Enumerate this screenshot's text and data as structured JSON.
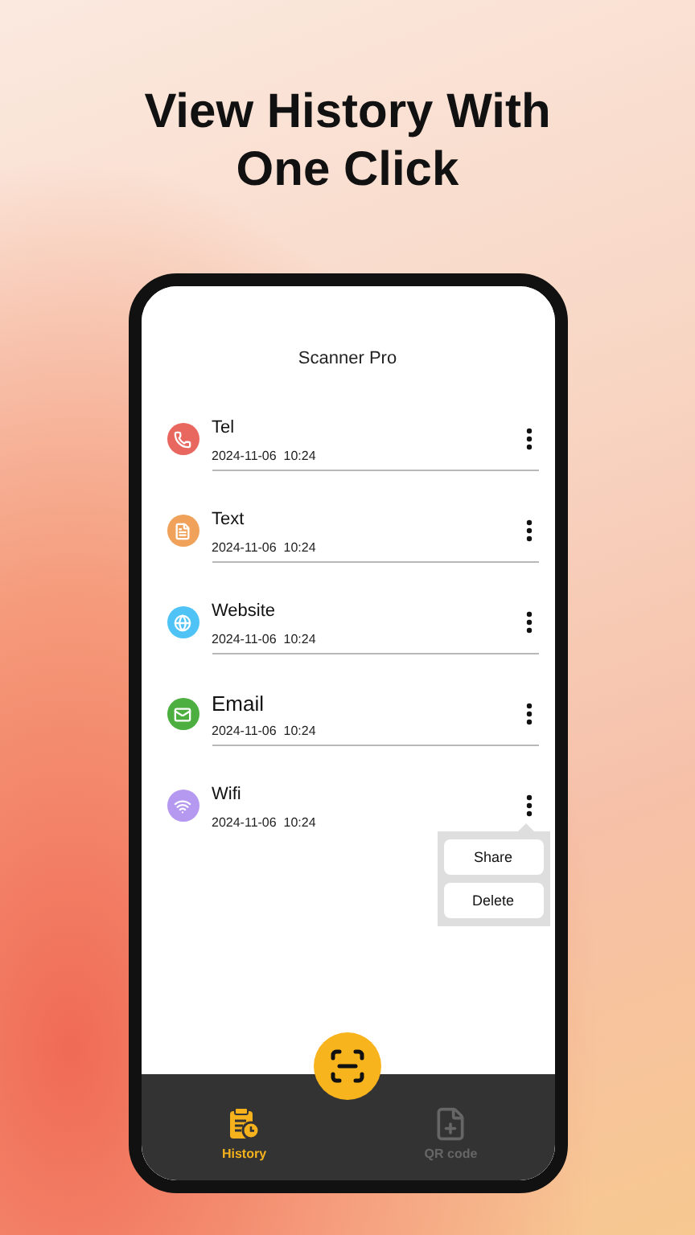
{
  "headline": "View History With One Click",
  "app": {
    "title": "Scanner Pro"
  },
  "history": [
    {
      "kind": "tel",
      "title": "Tel",
      "date": "2024-11-06  10:24",
      "color": "#e8675f",
      "menu_open": false
    },
    {
      "kind": "text",
      "title": "Text",
      "date": "2024-11-06  10:24",
      "color": "#f0a25a",
      "menu_open": false
    },
    {
      "kind": "website",
      "title": "Website",
      "date": "2024-11-06  10:24",
      "color": "#4fc3f5",
      "menu_open": false
    },
    {
      "kind": "email",
      "title": "Email",
      "date": "2024-11-06  10:24",
      "color": "#4caf3f",
      "menu_open": false
    },
    {
      "kind": "wifi",
      "title": "Wifi",
      "date": "2024-11-06  10:24",
      "color": "#b598ef",
      "menu_open": true
    }
  ],
  "menu": [
    "Share",
    "Delete"
  ],
  "nav": [
    {
      "kind": "history",
      "label": "History",
      "selected": true
    },
    {
      "kind": "qr",
      "label": "QR code",
      "selected": false
    }
  ]
}
